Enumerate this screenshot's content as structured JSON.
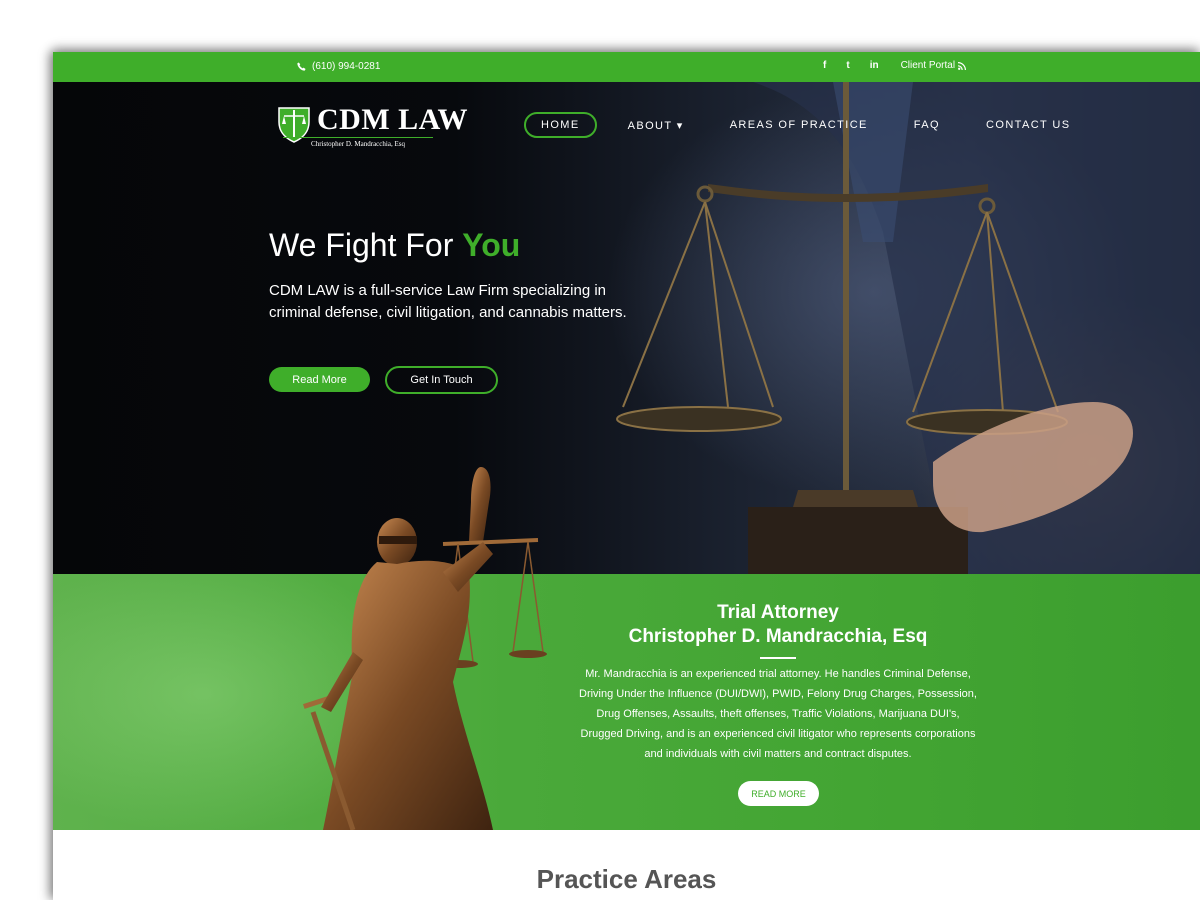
{
  "topbar": {
    "phone": "(610) 994-0281",
    "social": [
      "f",
      "t",
      "in"
    ],
    "client_portal": "Client Portal",
    "color": "#3fae2a"
  },
  "logo": {
    "name": "CDM LAW",
    "tagline": "Christopher D. Mandracchia, Esq"
  },
  "nav": {
    "items": [
      {
        "label": "HOME"
      },
      {
        "label": "ABOUT ▾"
      },
      {
        "label": "AREAS OF PRACTICE"
      },
      {
        "label": "FAQ"
      },
      {
        "label": "CONTACT US"
      }
    ]
  },
  "hero": {
    "headline_pre": "We Fight For",
    "headline_accent": "You",
    "intro": "CDM LAW is a full-service Law Firm specializing in criminal defense, civil litigation, and cannabis matters.",
    "read_more": "Read More",
    "get_in_touch": "Get In Touch"
  },
  "attorney": {
    "title_line1": "Trial Attorney",
    "title_line2": "Christopher D. Mandracchia, Esq",
    "bio": "Mr. Mandracchia is an experienced trial attorney. He handles Criminal Defense, Driving Under the Influence (DUI/DWI), PWID, Felony Drug Charges, Possession, Drug Offenses, Assaults, theft offenses, Traffic Violations, Marijuana DUI's, Drugged Driving, and is an experienced civil litigator who represents corporations and individuals with civil matters and contract disputes.",
    "read_more": "READ MORE"
  },
  "practice": {
    "heading": "Practice Areas"
  }
}
